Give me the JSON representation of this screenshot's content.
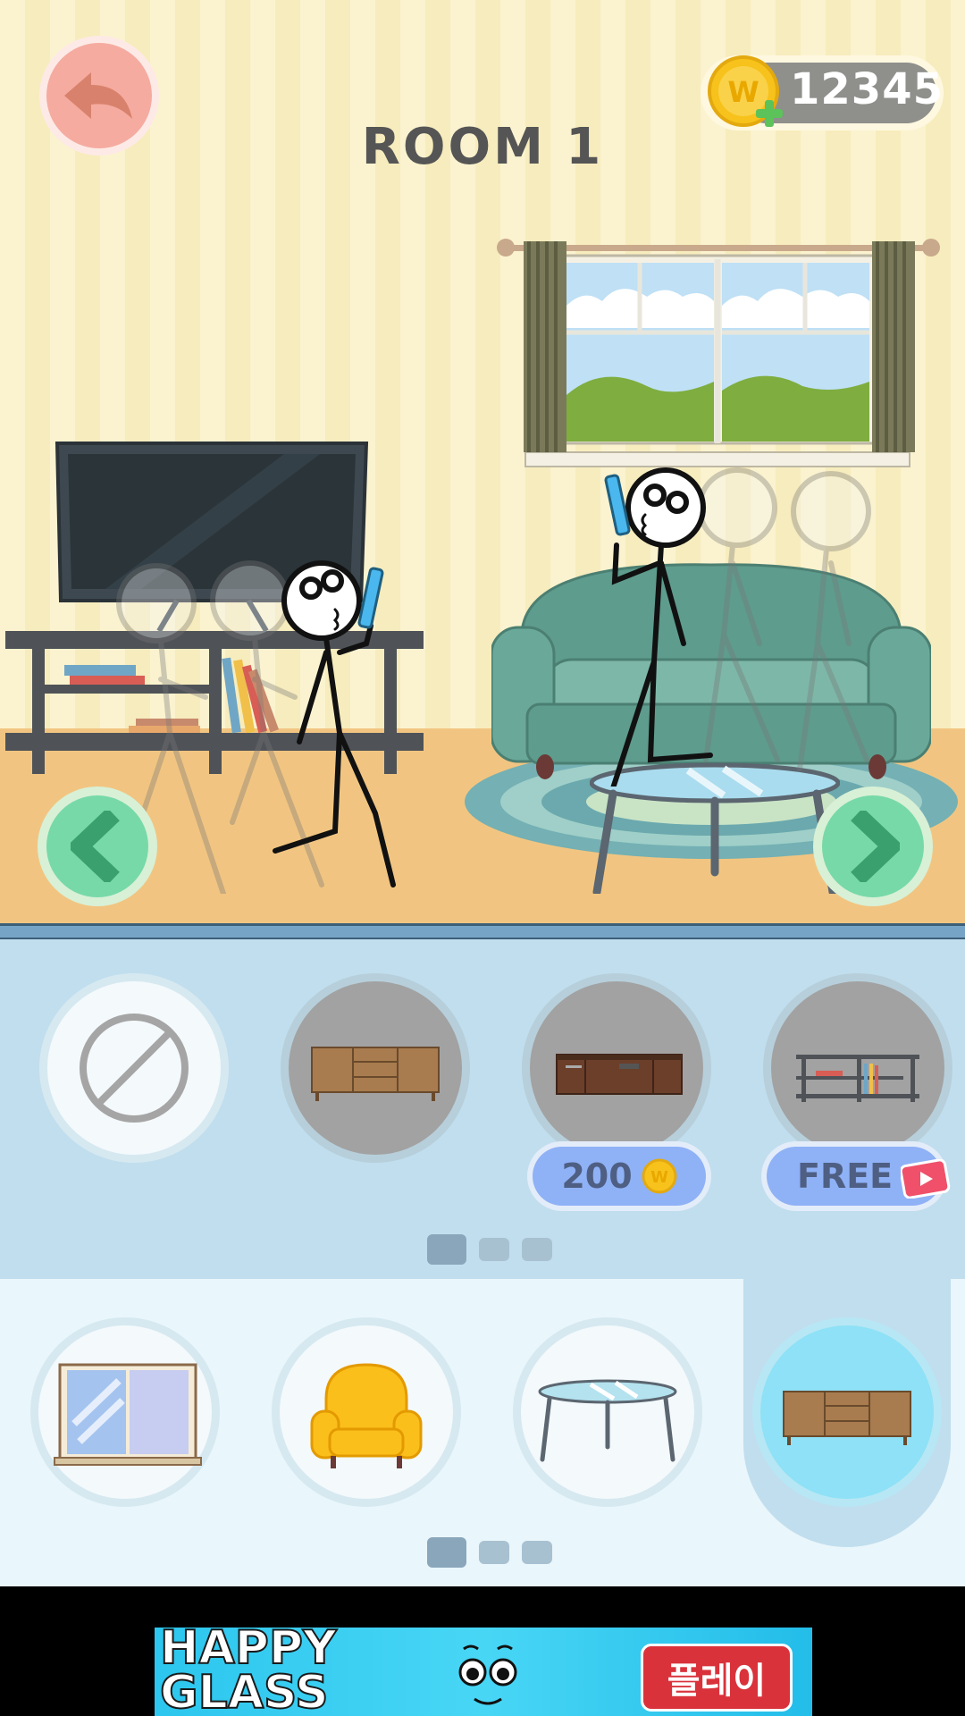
{
  "header": {
    "title": "ROOM 1",
    "coins": "12345"
  },
  "tabs": {
    "pager_1_pages": 3,
    "pager_1_active": 1,
    "pager_2_pages": 3,
    "pager_2_active": 1
  },
  "variants": [
    {
      "item": "none",
      "price": ""
    },
    {
      "item": "sideboard",
      "price": ""
    },
    {
      "item": "dark-tv-stand",
      "price": "200"
    },
    {
      "item": "shelf-tv-stand",
      "price": "FREE"
    }
  ],
  "categories": [
    {
      "item": "window"
    },
    {
      "item": "armchair"
    },
    {
      "item": "coffee-table"
    },
    {
      "item": "sideboard",
      "selected": true
    }
  ],
  "ad": {
    "title_line1": "HAPPY",
    "title_line2": "GLASS",
    "button": "플레이"
  },
  "colors": {
    "accent_green": "#77d9a8",
    "back_pink": "#f5aba0",
    "price_blue": "#8fb1f6",
    "coin_gold": "#f7c21b"
  }
}
